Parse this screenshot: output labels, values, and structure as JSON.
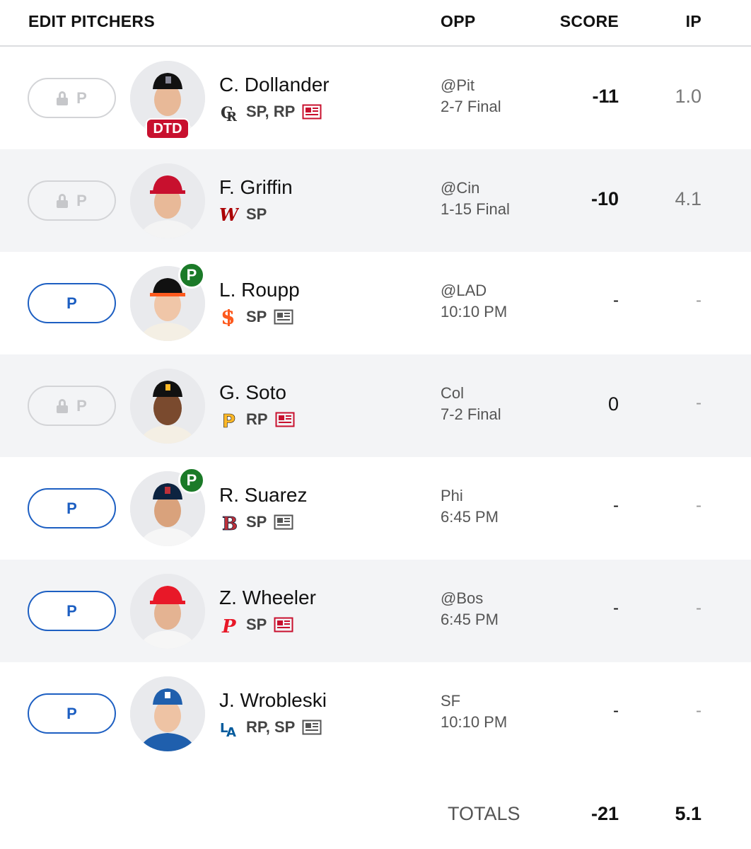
{
  "header": {
    "title": "EDIT PITCHERS",
    "opp": "OPP",
    "score": "SCORE",
    "ip": "IP"
  },
  "colors": {
    "accent": "#1d5fc2",
    "dtd": "#c8102e",
    "probable": "#1b7a28",
    "locked": "#c6c7ca"
  },
  "rows": [
    {
      "pos": "P",
      "locked": true,
      "name": "C. Dollander",
      "team_logo": "rockies-logo",
      "elig": "SP, RP",
      "news": "news-icon-red",
      "badge": "DTD",
      "opp": "@Pit",
      "status": "2-7 Final",
      "score": "-11",
      "ip": "1.0"
    },
    {
      "pos": "P",
      "locked": true,
      "name": "F. Griffin",
      "team_logo": "nationals-logo",
      "elig": "SP",
      "news": "",
      "badge": "",
      "opp": "@Cin",
      "status": "1-15 Final",
      "score": "-10",
      "ip": "4.1"
    },
    {
      "pos": "P",
      "locked": false,
      "name": "L. Roupp",
      "team_logo": "giants-logo",
      "elig": "SP",
      "news": "news-icon-gray",
      "badge": "P",
      "opp": "@LAD",
      "status": "10:10 PM",
      "score": "-",
      "ip": "-"
    },
    {
      "pos": "P",
      "locked": true,
      "name": "G. Soto",
      "team_logo": "pirates-logo",
      "elig": "RP",
      "news": "news-icon-red",
      "badge": "",
      "opp": "Col",
      "status": "7-2 Final",
      "score": "0",
      "ip": "-"
    },
    {
      "pos": "P",
      "locked": false,
      "name": "R. Suarez",
      "team_logo": "red-sox-logo",
      "elig": "SP",
      "news": "news-icon-gray",
      "badge": "P",
      "opp": "Phi",
      "status": "6:45 PM",
      "score": "-",
      "ip": "-"
    },
    {
      "pos": "P",
      "locked": false,
      "name": "Z. Wheeler",
      "team_logo": "phillies-logo",
      "elig": "SP",
      "news": "news-icon-red",
      "badge": "",
      "opp": "@Bos",
      "status": "6:45 PM",
      "score": "-",
      "ip": "-"
    },
    {
      "pos": "P",
      "locked": false,
      "name": "J. Wrobleski",
      "team_logo": "dodgers-logo",
      "elig": "RP, SP",
      "news": "news-icon-gray",
      "badge": "",
      "opp": "SF",
      "status": "10:10 PM",
      "score": "-",
      "ip": "-"
    }
  ],
  "totals": {
    "label": "TOTALS",
    "score": "-21",
    "ip": "5.1"
  }
}
